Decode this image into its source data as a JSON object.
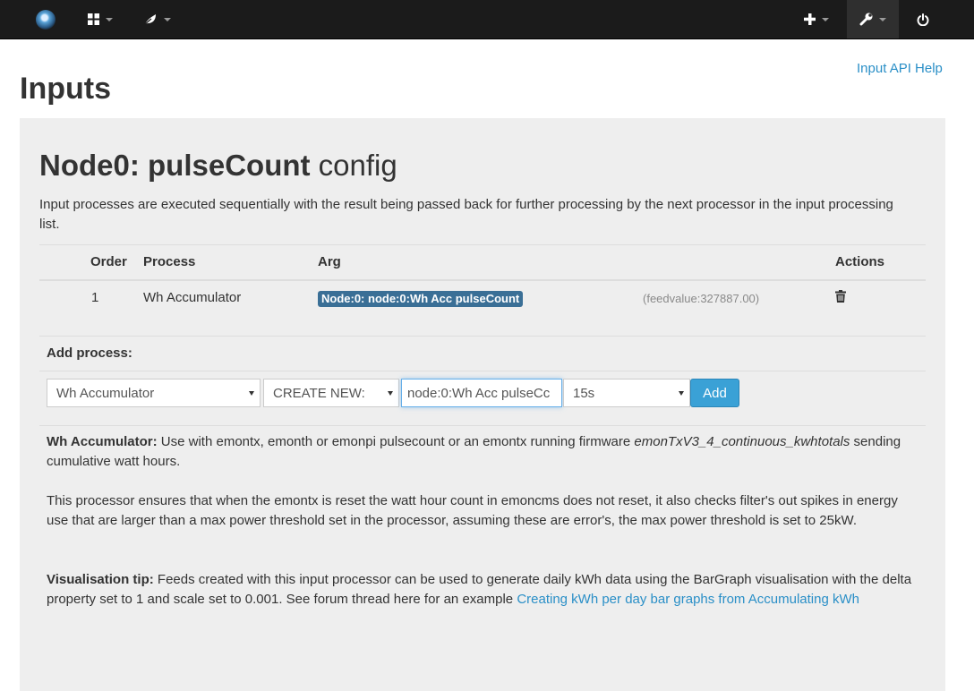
{
  "nav": {
    "logo_icon": "emoncms-logo",
    "items": [
      {
        "icon": "grid-icon"
      },
      {
        "icon": "leaf-icon"
      },
      {
        "icon": "plus-icon"
      },
      {
        "icon": "wrench-icon"
      },
      {
        "icon": "power-icon"
      }
    ]
  },
  "header": {
    "title": "Inputs",
    "api_help": "Input API Help"
  },
  "config": {
    "title_bold": "Node0: pulseCount",
    "title_rest": " config",
    "intro": "Input processes are executed sequentially with the result being passed back for further processing by the next processor in the input processing list."
  },
  "table": {
    "headers": {
      "order": "Order",
      "process": "Process",
      "arg": "Arg",
      "actions": "Actions"
    },
    "rows": [
      {
        "order": "1",
        "process": "Wh Accumulator",
        "arg": "Node:0: node:0:Wh Acc pulseCount",
        "feedvalue": "(feedvalue:327887.00)"
      }
    ]
  },
  "add_process": {
    "label": "Add process:",
    "process_select": "Wh Accumulator",
    "feed_select": "CREATE NEW:",
    "feed_name_value": "node:0:Wh Acc pulseCc",
    "interval_select": "15s",
    "add_button": "Add"
  },
  "description": {
    "p1_bold": "Wh Accumulator:",
    "p1_text": " Use with emontx, emonth or emonpi pulsecount or an emontx running firmware ",
    "p1_italic": "emonTxV3_4_continuous_kwhtotals",
    "p1_end": " sending cumulative watt hours.",
    "p2": "This processor ensures that when the emontx is reset the watt hour count in emoncms does not reset, it also checks filter's out spikes in energy use that are larger than a max power threshold set in the processor, assuming these are error's, the max power threshold is set to 25kW.",
    "p3_bold": "Visualisation tip:",
    "p3_text": " Feeds created with this input processor can be used to generate daily kWh data using the BarGraph visualisation with the delta property set to 1 and scale set to 0.001. See forum thread here for an example ",
    "p3_link": "Creating kWh per day bar graphs from Accumulating kWh"
  },
  "colors": {
    "navbar": "#1b1b1b",
    "link": "#2a8fc7",
    "label": "#3a6f96",
    "button": "#3aa1d6",
    "well": "#eeeeee"
  }
}
